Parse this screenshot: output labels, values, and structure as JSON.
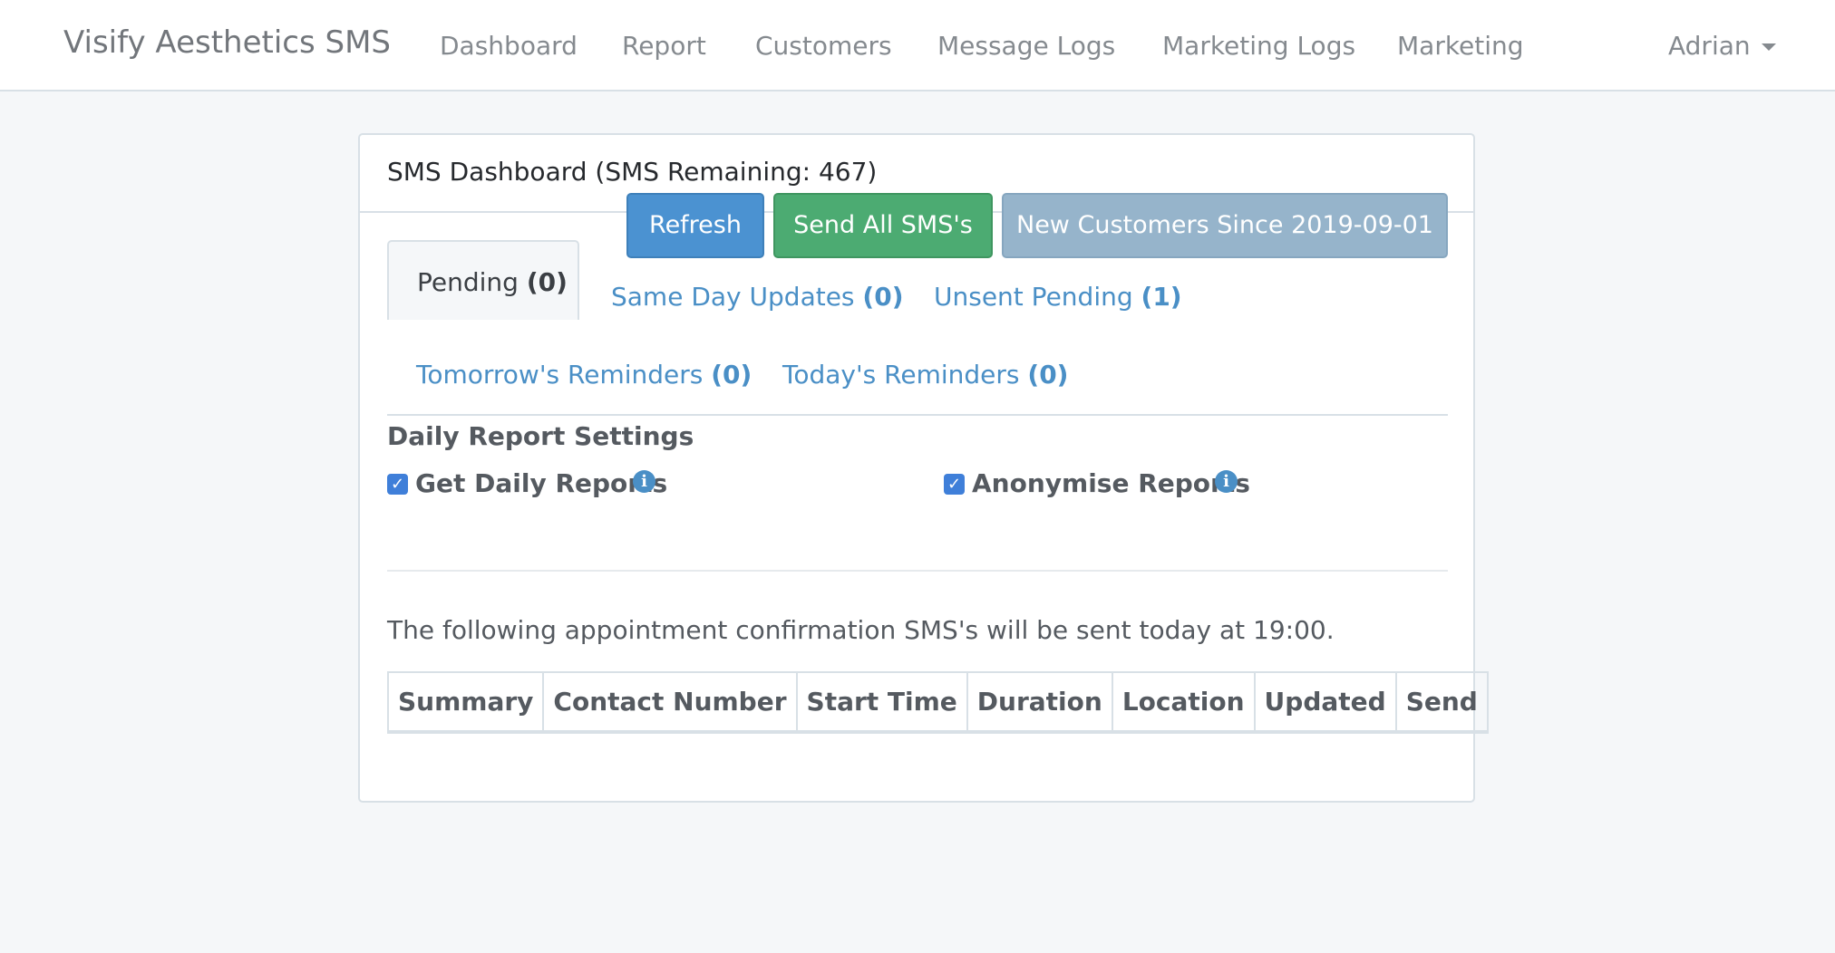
{
  "navbar": {
    "brand": "Visify Aesthetics SMS",
    "items": [
      "Dashboard",
      "Report",
      "Customers",
      "Message Logs",
      "Marketing Logs",
      "Marketing"
    ],
    "user": "Adrian"
  },
  "panel": {
    "title": "SMS Dashboard (SMS Remaining: 467)",
    "buttons": {
      "refresh": "Refresh",
      "send_all": "Send All SMS's",
      "new_customers": "New Customers Since 2019-09-01"
    },
    "tabs": [
      {
        "label": "Pending",
        "count": "(0)"
      },
      {
        "label": "Same Day Updates",
        "count": "(0)"
      },
      {
        "label": "Unsent Pending",
        "count": "(1)"
      },
      {
        "label": "Tomorrow's Reminders",
        "count": "(0)"
      },
      {
        "label": "Today's Reminders",
        "count": "(0)"
      }
    ],
    "daily_settings": {
      "title": "Daily Report Settings",
      "get_daily_reports": "Get Daily Reports",
      "anonymise_reports": "Anonymise Reports"
    },
    "info_text": "The following appointment confirmation SMS's will be sent today at 19:00.",
    "table": {
      "headers": [
        "Summary",
        "Contact Number",
        "Start Time",
        "Duration",
        "Location",
        "Updated",
        "Send"
      ]
    }
  },
  "colors": {
    "primary": "#4b92d1",
    "success": "#4cab72",
    "muted_button": "#96b4cb",
    "link": "#4a8fc6"
  }
}
